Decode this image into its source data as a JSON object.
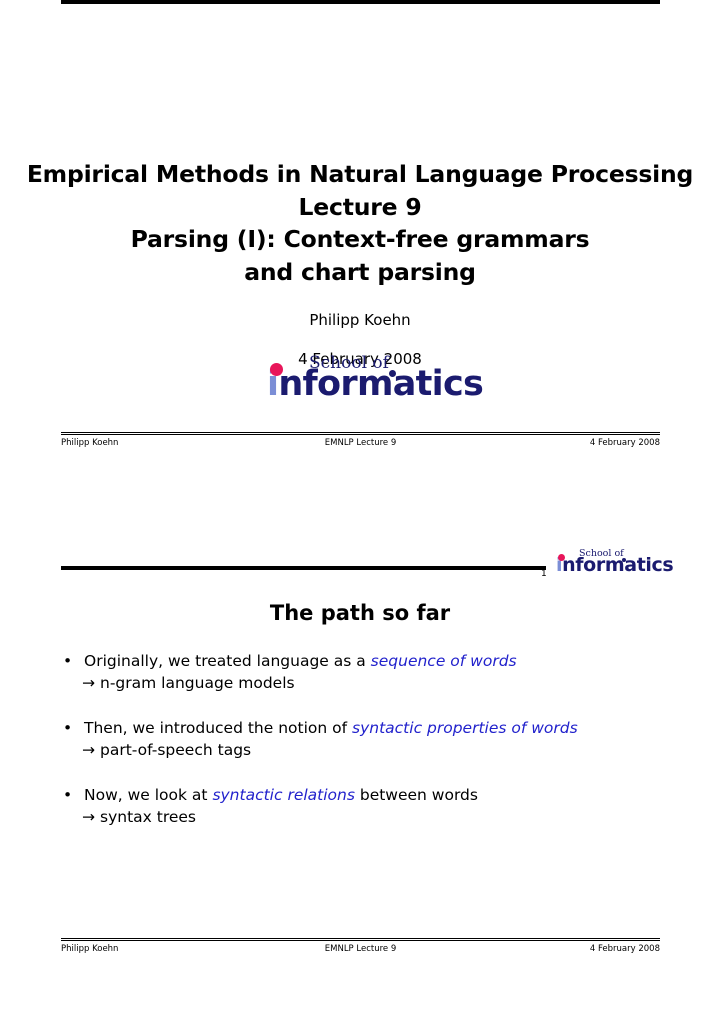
{
  "document": {
    "title_page": {
      "title_lines": [
        "Empirical Methods in Natural Language Processing",
        "Lecture 9",
        "Parsing (I): Context-free grammars",
        "and chart parsing"
      ],
      "author": "Philipp Koehn",
      "date": "4 February 2008"
    },
    "logo": {
      "school_of": "School of",
      "lead_letter": "i",
      "word_rest": "nformatics",
      "colors": {
        "navy": "#1b1b6f",
        "periwinkle": "#7b8ed6",
        "pink_dot": "#e8165a"
      }
    },
    "footer": {
      "left": "Philipp Koehn",
      "center": "EMNLP Lecture 9",
      "right": "4 February 2008"
    },
    "slide": {
      "page_number": "1",
      "heading": "The path so far",
      "bullets": [
        {
          "bullet_char": "•",
          "text_before": "Originally, we treated language as a ",
          "highlight": "sequence of words",
          "text_after": "",
          "arrow": "→",
          "sub_text": "n-gram language models"
        },
        {
          "bullet_char": "•",
          "text_before": "Then, we introduced the notion of ",
          "highlight": "syntactic properties of words",
          "text_after": "",
          "arrow": "→",
          "sub_text": "part-of-speech tags"
        },
        {
          "bullet_char": "•",
          "text_before": "Now, we look at ",
          "highlight": "syntactic relations",
          "text_after": " between words",
          "arrow": "→",
          "sub_text": "syntax trees"
        }
      ],
      "highlight_color": "#2222cc"
    }
  }
}
